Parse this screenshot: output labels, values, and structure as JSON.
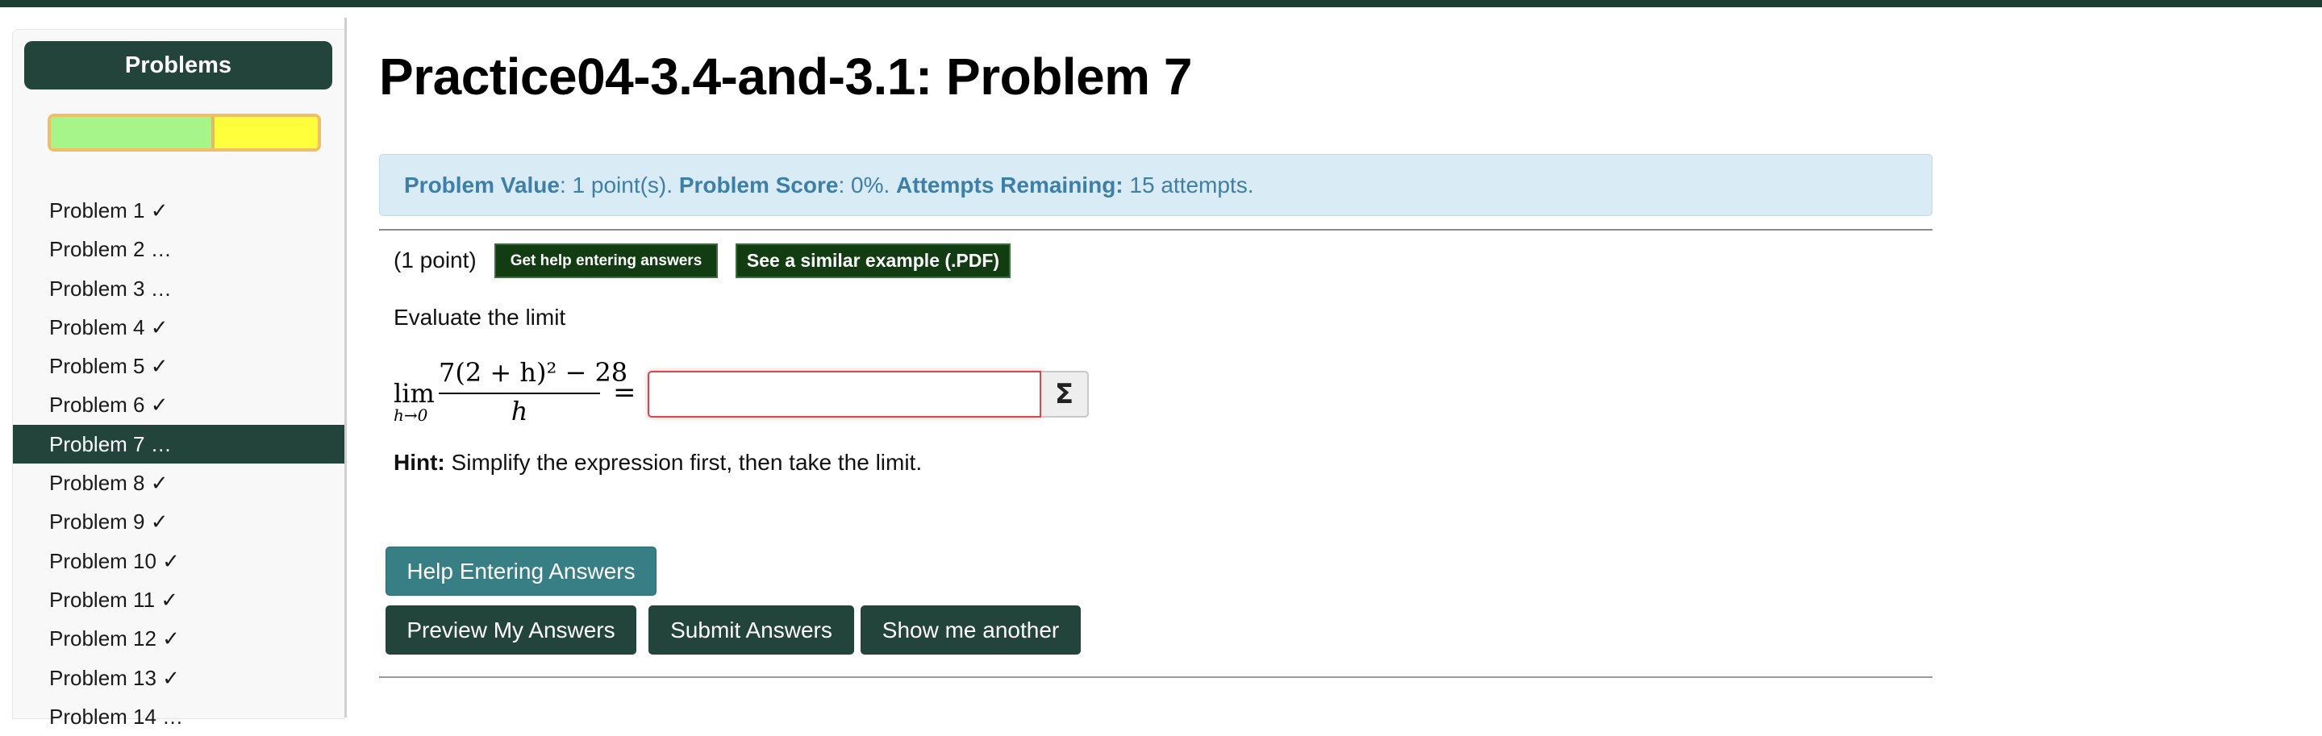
{
  "sidebar": {
    "problems_button": "Problems",
    "progress": {
      "completed_fraction": 0.61,
      "current_fraction": 0.39
    },
    "items": [
      {
        "label": "Problem 1 ✓"
      },
      {
        "label": "Problem 2 …"
      },
      {
        "label": "Problem 3 …"
      },
      {
        "label": "Problem 4 ✓"
      },
      {
        "label": "Problem 5 ✓"
      },
      {
        "label": "Problem 6 ✓"
      },
      {
        "label": "Problem 7 …"
      },
      {
        "label": "Problem 8 ✓"
      },
      {
        "label": "Problem 9 ✓"
      },
      {
        "label": "Problem 10 ✓"
      },
      {
        "label": "Problem 11 ✓"
      },
      {
        "label": "Problem 12 ✓"
      },
      {
        "label": "Problem 13 ✓"
      },
      {
        "label": "Problem 14 …"
      }
    ],
    "active_index": 6
  },
  "main": {
    "title": "Practice04-3.4-and-3.1: Problem 7",
    "info": {
      "value_label": "Problem Value",
      "value_text": ": 1 point(s). ",
      "score_label": "Problem Score",
      "score_text": ": 0%. ",
      "attempts_label": "Attempts Remaining:",
      "attempts_text": " 15 attempts."
    },
    "points": "(1 point)",
    "help_small_button": "Get help entering answers",
    "similar_button": "See a similar example (.PDF)",
    "instruction": "Evaluate the limit",
    "math": {
      "lim": "lim",
      "lim_sub": "h→0",
      "numerator": "7(2 + h)² − 28",
      "denominator": "h",
      "equals": "="
    },
    "answer_input": {
      "value": "",
      "placeholder": ""
    },
    "sigma_button": "Σ",
    "hint_label": "Hint:",
    "hint_text": " Simplify the expression first, then take the limit.",
    "buttons": {
      "help_entering": "Help Entering Answers",
      "preview": "Preview My Answers",
      "submit": "Submit Answers",
      "another": "Show me another"
    }
  },
  "colors": {
    "dark_green": "#23443a",
    "teal": "#377f84",
    "info_bg": "#d9ebf5",
    "info_text": "#3c7fa8",
    "progress_ok": "#a6f58a",
    "progress_open": "#ffff3c"
  }
}
